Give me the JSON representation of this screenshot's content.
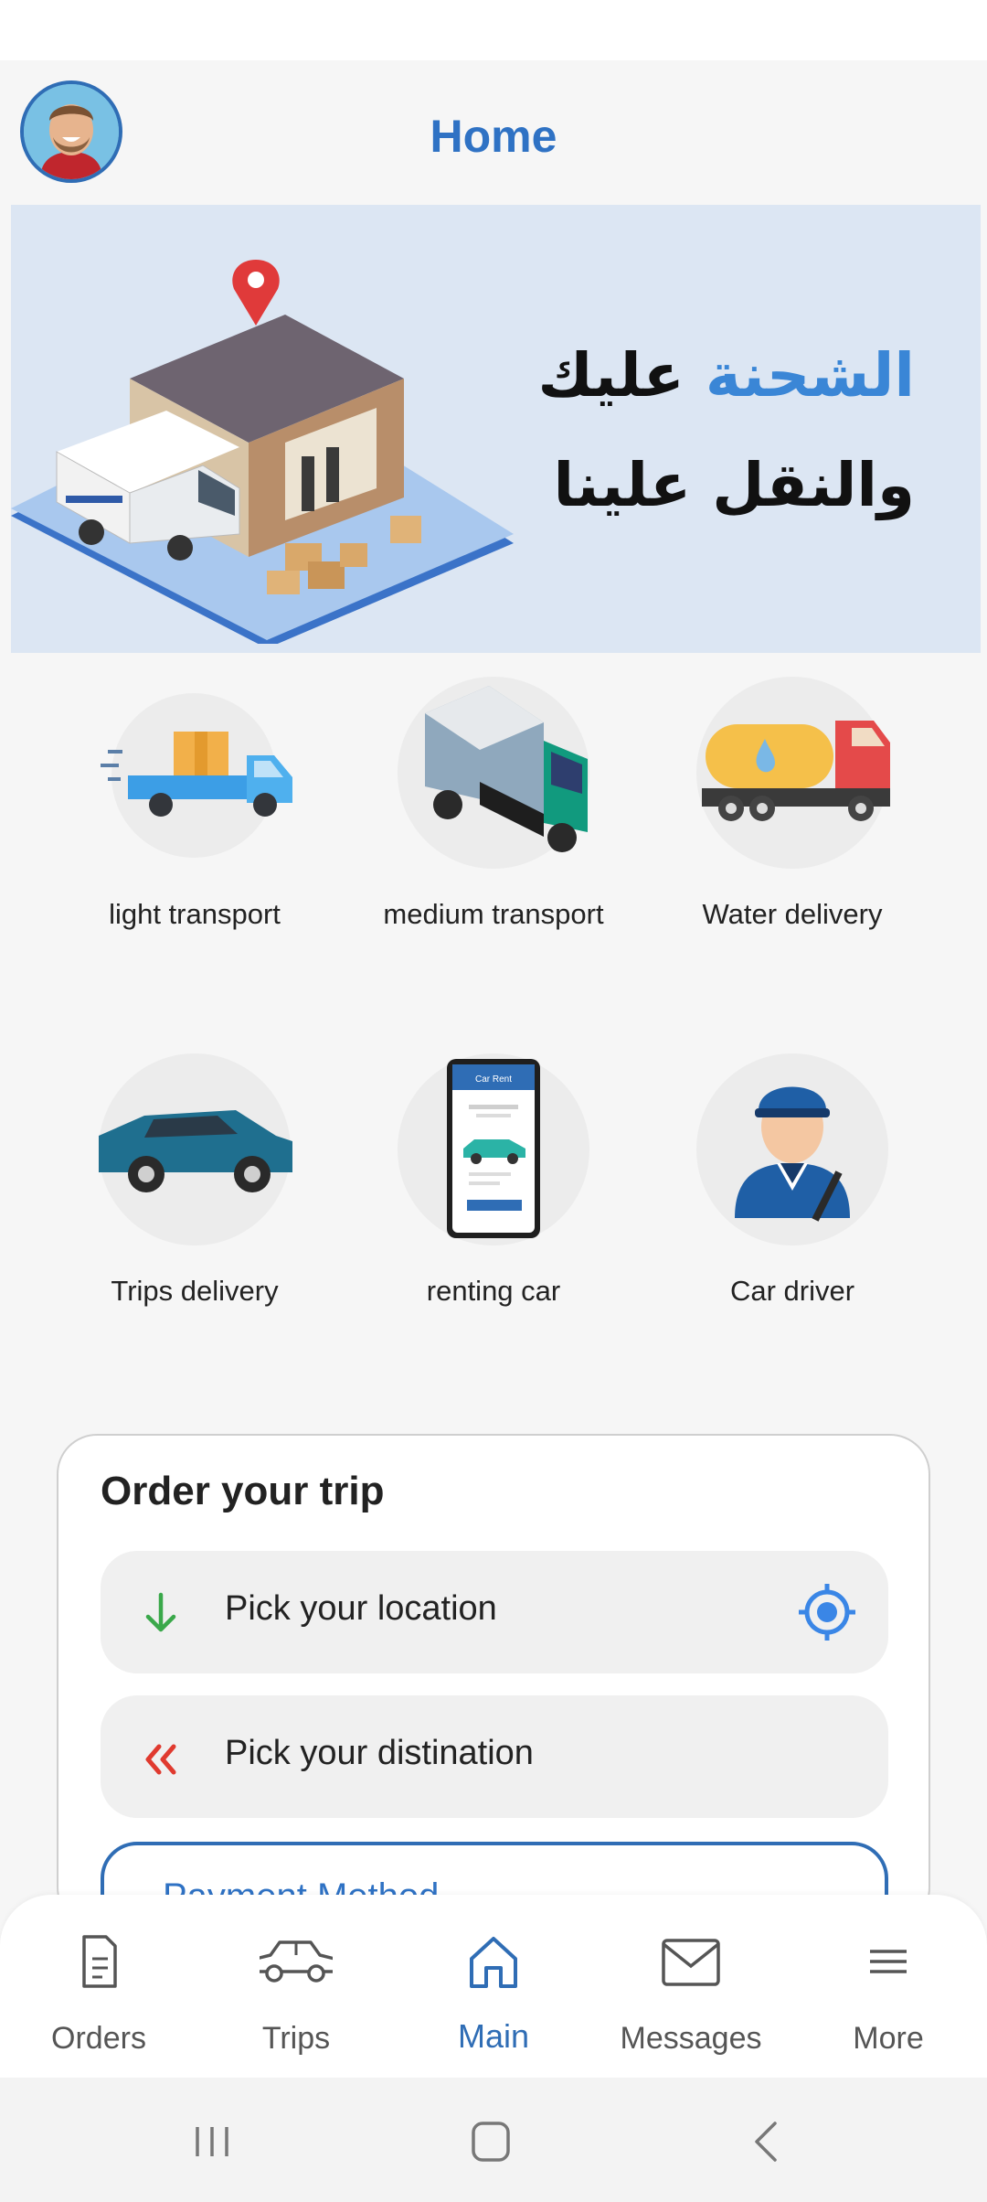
{
  "header": {
    "title": "Home"
  },
  "banner": {
    "line1_accent": "الشحنة",
    "line1_rest": "عليك",
    "line2": "والنقل علينا"
  },
  "services": [
    {
      "label": "light transport",
      "icon": "light-truck-icon"
    },
    {
      "label": "medium transport",
      "icon": "medium-truck-icon"
    },
    {
      "label": "Water delivery",
      "icon": "water-tanker-icon"
    },
    {
      "label": "Trips delivery",
      "icon": "suv-car-icon"
    },
    {
      "label": "renting car",
      "icon": "phone-car-rent-icon"
    },
    {
      "label": "Car driver",
      "icon": "driver-icon"
    }
  ],
  "phone_screen": {
    "title": "Car Rent"
  },
  "order": {
    "title": "Order your trip",
    "pickup_text": "Pick your location",
    "destination_text": "Pick your distination",
    "payment_text": "Payment Method"
  },
  "nav": [
    {
      "label": "Orders",
      "icon": "document-icon"
    },
    {
      "label": "Trips",
      "icon": "car-icon"
    },
    {
      "label": "Main",
      "icon": "home-icon"
    },
    {
      "label": "Messages",
      "icon": "mail-icon"
    },
    {
      "label": "More",
      "icon": "menu-icon"
    }
  ],
  "colors": {
    "accent": "#2f72c4",
    "banner_bg": "#dce6f3",
    "pickup_arrow": "#3aa84a",
    "destination_arrow": "#e03a2f"
  }
}
